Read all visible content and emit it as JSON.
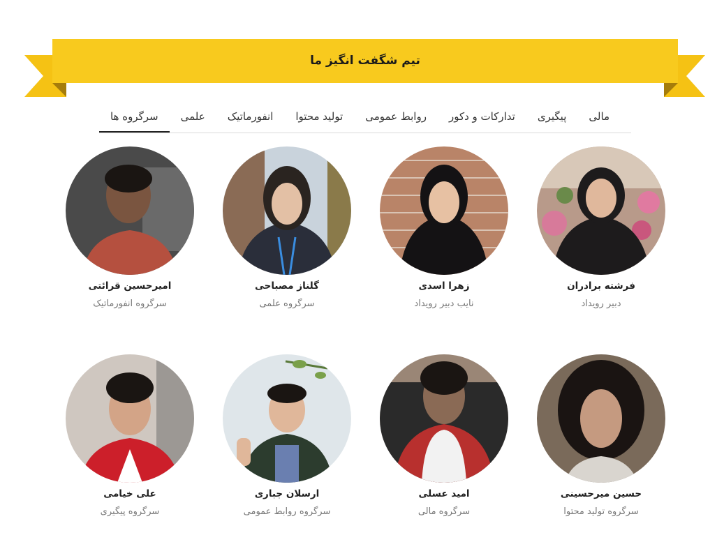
{
  "banner": {
    "title": "تیم شگفت انگیز ما"
  },
  "tabs": [
    {
      "label": "سرگروه ها",
      "active": true
    },
    {
      "label": "علمی",
      "active": false
    },
    {
      "label": "انفورماتیک",
      "active": false
    },
    {
      "label": "تولید محتوا",
      "active": false
    },
    {
      "label": "روابط عمومی",
      "active": false
    },
    {
      "label": "تدارکات و دکور",
      "active": false
    },
    {
      "label": "پیگیری",
      "active": false
    },
    {
      "label": "مالی",
      "active": false
    }
  ],
  "members": [
    {
      "name": "فرشته برادران",
      "role": "دبیر رویداد"
    },
    {
      "name": "زهرا اسدی",
      "role": "نایب دبیر رویداد"
    },
    {
      "name": "گلناز مصباحی",
      "role": "سرگروه علمی"
    },
    {
      "name": "امیرحسین قرائتی",
      "role": "سرگروه انفورماتیک"
    },
    {
      "name": "حسین میرحسینی",
      "role": "سرگروه تولید محتوا"
    },
    {
      "name": "امید عسلی",
      "role": "سرگروه مالی"
    },
    {
      "name": "ارسلان جباری",
      "role": "سرگروه روابط عمومی"
    },
    {
      "name": "علی خیامی",
      "role": "سرگروه پیگیری"
    }
  ],
  "colors": {
    "ribbon": "#f7c71f",
    "ribbon_dark": "#c99a10"
  }
}
